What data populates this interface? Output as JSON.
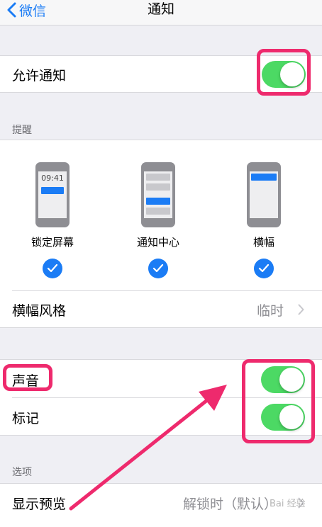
{
  "nav": {
    "back_label": "微信",
    "title": "通知"
  },
  "allow_notifications": {
    "label": "允许通知",
    "on": true
  },
  "alerts_section": {
    "header": "提醒",
    "styles": [
      {
        "label": "锁定屏幕",
        "selected": true,
        "time": "09:41"
      },
      {
        "label": "通知中心",
        "selected": true
      },
      {
        "label": "横幅",
        "selected": true
      }
    ],
    "banner_style": {
      "label": "横幅风格",
      "value": "临时"
    }
  },
  "sound": {
    "label": "声音",
    "on": true
  },
  "badge": {
    "label": "标记",
    "on": true
  },
  "options_section": {
    "header": "选项",
    "show_previews": {
      "label": "显示预览",
      "value": "解锁时（默认）"
    }
  },
  "colors": {
    "accent": "#1b7cf5",
    "switch_on": "#4cd964",
    "highlight": "#ee2a6d"
  }
}
